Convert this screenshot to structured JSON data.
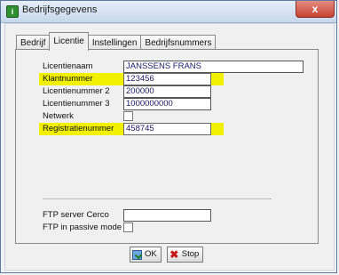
{
  "window": {
    "title": "Bedrijfsgegevens",
    "close_glyph": "x",
    "app_icon_glyph": "i"
  },
  "tabs": [
    {
      "label": "Bedrijf",
      "active": false
    },
    {
      "label": "Licentie",
      "active": true
    },
    {
      "label": "Instellingen",
      "active": false
    },
    {
      "label": "Bedrijfsnummers",
      "active": false
    }
  ],
  "form": {
    "licentienaam": {
      "label": "Licentienaam",
      "value": "JANSSENS FRANS"
    },
    "klantnummer": {
      "label": "Klantnummer",
      "value": "123456"
    },
    "licentienummer2": {
      "label": "Licentienummer 2",
      "value": "200000"
    },
    "licentienummer3": {
      "label": "Licentienummer 3",
      "value": "1000000000"
    },
    "netwerk": {
      "label": "Netwerk",
      "checked": false
    },
    "registratienummer": {
      "label": "Registratienummer",
      "value": "458745"
    },
    "ftp_server": {
      "label": "FTP server Cerco",
      "value": ""
    },
    "ftp_passive": {
      "label": "FTP in passive mode",
      "checked": false
    }
  },
  "buttons": {
    "ok_label": "OK",
    "stop_label": "Stop"
  },
  "colors": {
    "highlight": "#f0f000",
    "field_text": "#1a1a66"
  }
}
